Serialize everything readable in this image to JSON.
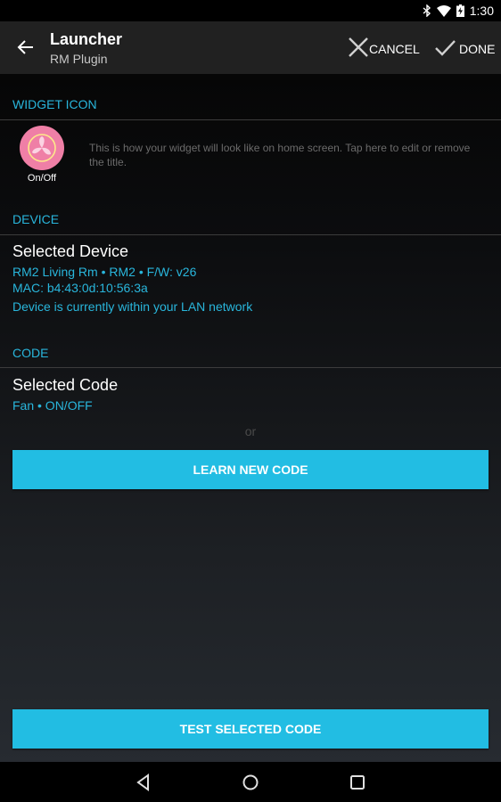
{
  "status_bar": {
    "time": "1:30",
    "icons": [
      "bluetooth-icon",
      "wifi-icon",
      "battery-charging-icon"
    ]
  },
  "app_bar": {
    "title": "Launcher",
    "subtitle": "RM Plugin",
    "back_icon": "arrow-back-icon",
    "cancel_label": "CANCEL",
    "done_label": "DONE"
  },
  "widget_section": {
    "header": "WIDGET ICON",
    "icon": "fan-icon",
    "icon_color": "#ef7fa6",
    "icon_label": "On/Off",
    "description": "This is how your widget will look like on home screen. Tap here to edit or remove the title."
  },
  "device_section": {
    "header": "DEVICE",
    "title": "Selected Device",
    "info_line": "RM2 Living Rm • RM2 • F/W: v26",
    "mac_line": "MAC: b4:43:0d:10:56:3a",
    "network_status": "Device is currently within your LAN network"
  },
  "code_section": {
    "header": "CODE",
    "title": "Selected Code",
    "code_line": "Fan • ON/OFF",
    "or_text": "or",
    "learn_button": "LEARN NEW CODE"
  },
  "test_button": "TEST SELECTED CODE",
  "colors": {
    "accent": "#29b6dc",
    "button": "#22bde3",
    "app_bar": "#212121"
  },
  "nav_bar": {
    "buttons": [
      "back-nav-icon",
      "home-nav-icon",
      "recents-nav-icon"
    ]
  }
}
